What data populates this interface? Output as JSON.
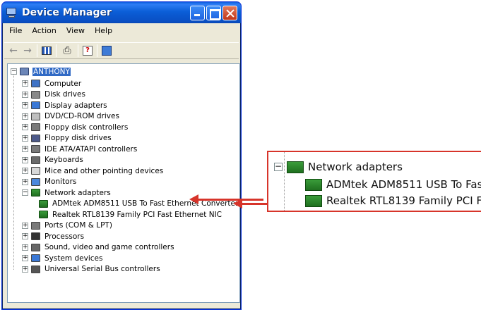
{
  "window": {
    "title": "Device Manager",
    "controls": {
      "minimize": "",
      "maximize": "",
      "close": ""
    }
  },
  "menu": [
    "File",
    "Action",
    "View",
    "Help"
  ],
  "toolbar": {
    "icons": [
      "back-arrow-icon",
      "forward-arrow-icon",
      "device-list-icon",
      "print-icon",
      "properties-icon",
      "scan-hardware-icon"
    ]
  },
  "tree": {
    "root": "ANTHONY",
    "items": [
      {
        "label": "Computer",
        "icon": "computer-icon",
        "color": "#3f73c6"
      },
      {
        "label": "Disk drives",
        "icon": "disk-icon",
        "color": "#8a8a8a"
      },
      {
        "label": "Display adapters",
        "icon": "display-icon",
        "color": "#3a78d6"
      },
      {
        "label": "DVD/CD-ROM drives",
        "icon": "cdrom-icon",
        "color": "#bfbfbf"
      },
      {
        "label": "Floppy disk controllers",
        "icon": "controller-icon",
        "color": "#7a7a7a"
      },
      {
        "label": "Floppy disk drives",
        "icon": "floppy-icon",
        "color": "#4d5a8a"
      },
      {
        "label": "IDE ATA/ATAPI controllers",
        "icon": "controller-icon",
        "color": "#7a7a7a"
      },
      {
        "label": "Keyboards",
        "icon": "keyboard-icon",
        "color": "#6a6a6a"
      },
      {
        "label": "Mice and other pointing devices",
        "icon": "mouse-icon",
        "color": "#d8d8d8"
      },
      {
        "label": "Monitors",
        "icon": "monitor-icon",
        "color": "#4b88dd"
      },
      {
        "label": "Network adapters",
        "icon": "network-card-icon",
        "color": "#2f8a2f",
        "expanded": true
      },
      {
        "label": "ADMtek ADM8511 USB To Fast Ethernet Converter",
        "icon": "network-card-icon",
        "color": "#2f8a2f",
        "child": true
      },
      {
        "label": "Realtek RTL8139 Family PCI Fast Ethernet NIC",
        "icon": "network-card-icon",
        "color": "#2f8a2f",
        "child": true
      },
      {
        "label": "Ports (COM & LPT)",
        "icon": "port-icon",
        "color": "#7a7a7a"
      },
      {
        "label": "Processors",
        "icon": "processor-icon",
        "color": "#333333"
      },
      {
        "label": "Sound, video and game controllers",
        "icon": "sound-icon",
        "color": "#666666"
      },
      {
        "label": "System devices",
        "icon": "system-icon",
        "color": "#3a78d6"
      },
      {
        "label": "Universal Serial Bus controllers",
        "icon": "usb-icon",
        "color": "#555555"
      }
    ]
  },
  "zoom": {
    "category": "Network adapters",
    "items": [
      "ADMtek ADM8511 USB To Fas",
      "Realtek RTL8139 Family PCI F"
    ],
    "accent": "#d7342a"
  }
}
